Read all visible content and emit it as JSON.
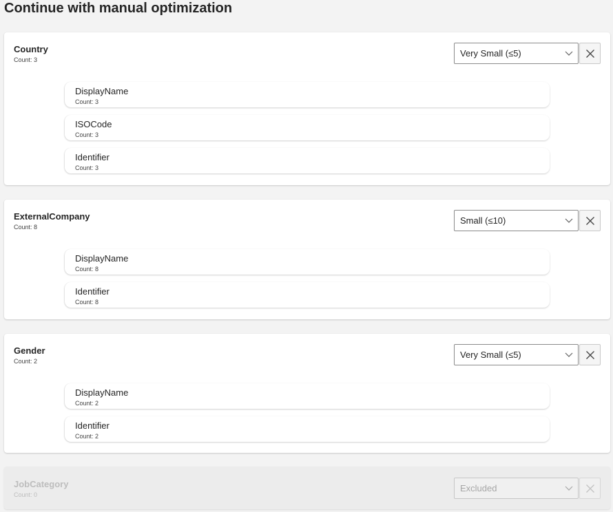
{
  "page": {
    "title": "Continue with manual optimization"
  },
  "entities": [
    {
      "name": "Country",
      "count": "Count: 3",
      "size": "Very Small (≤5)",
      "fields": [
        {
          "name": "DisplayName",
          "count": "Count: 3"
        },
        {
          "name": "ISOCode",
          "count": "Count: 3"
        },
        {
          "name": "Identifier",
          "count": "Count: 3"
        }
      ]
    },
    {
      "name": "ExternalCompany",
      "count": "Count: 8",
      "size": "Small (≤10)",
      "fields": [
        {
          "name": "DisplayName",
          "count": "Count: 8"
        },
        {
          "name": "Identifier",
          "count": "Count: 8"
        }
      ]
    },
    {
      "name": "Gender",
      "count": "Count: 2",
      "size": "Very Small (≤5)",
      "fields": [
        {
          "name": "DisplayName",
          "count": "Count: 2"
        },
        {
          "name": "Identifier",
          "count": "Count: 2"
        }
      ]
    },
    {
      "name": "JobCategory",
      "count": "Count: 0",
      "size": "Excluded",
      "disabled": true,
      "fields": []
    }
  ],
  "icons": {
    "dropdown": "chevron-down-icon",
    "remove": "close-icon"
  },
  "colors": {
    "background": "#f3f3f3",
    "card": "#ffffff",
    "disabled_card": "#ececec",
    "text": "#242424",
    "disabled_text": "#bdbdbd"
  }
}
